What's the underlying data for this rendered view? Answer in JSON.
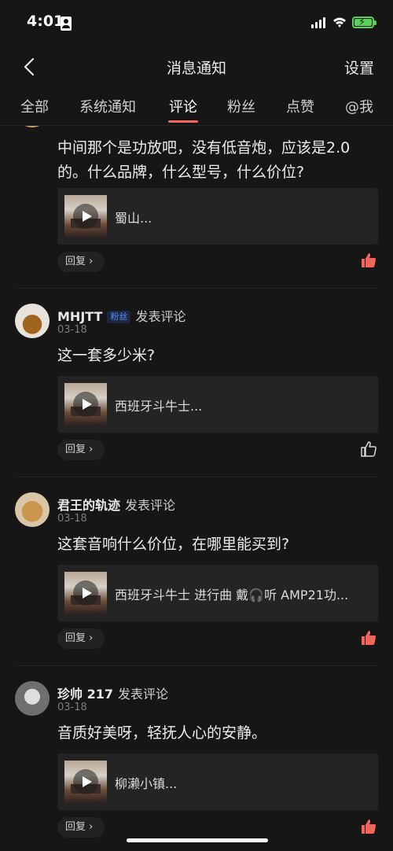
{
  "status_bar": {
    "time": "4:01"
  },
  "nav": {
    "title": "消息通知",
    "settings": "设置"
  },
  "tabs": [
    "全部",
    "系统通知",
    "评论",
    "粉丝",
    "点赞",
    "@我"
  ],
  "active_tab": "评论",
  "reply_label": "回复 ›",
  "action_label": "发表评论",
  "fan_badge": "粉丝",
  "comments": [
    {
      "text": "中间那个是功放吧，没有低音炮，应该是2.0的。什么品牌，什么型号，什么价位?",
      "media_title": "蜀山...",
      "liked": true
    },
    {
      "username": "MHJTT",
      "date": "03-18",
      "text": "这一套多少米?",
      "media_title": "西班牙斗牛士...",
      "liked": false
    },
    {
      "username": "君王的轨迹",
      "date": "03-18",
      "text": "这套音响什么价位，在哪里能买到?",
      "media_title": "西班牙斗牛士 进行曲 戴🎧听 AMP21功...",
      "liked": true
    },
    {
      "username": "珍帅 217",
      "date": "03-18",
      "text": "音质好美呀，轻抚人心的安静。",
      "media_title": "柳濑小镇...",
      "liked": true
    }
  ],
  "colors": {
    "accent": "#f2655a",
    "background": "#161616",
    "card": "#242424",
    "like_active": "#f2655a"
  }
}
